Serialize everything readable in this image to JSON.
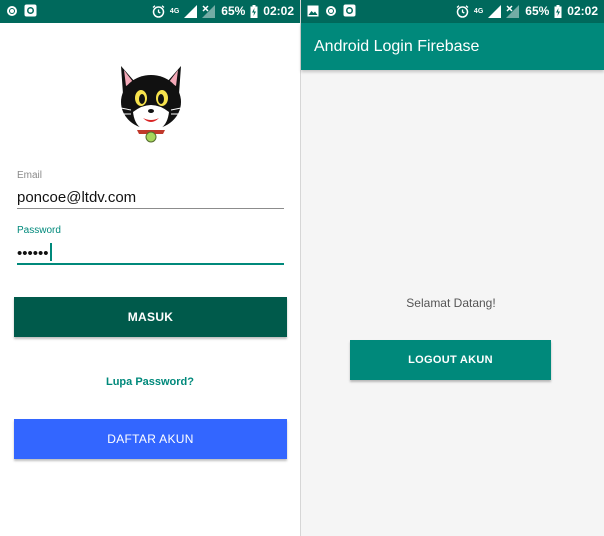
{
  "status_bar_left": {
    "battery_text": "65%",
    "network": "4G",
    "time": "02:02",
    "notification_icons": [
      "circle-icon",
      "camera-record-icon"
    ]
  },
  "status_bar_right": {
    "battery_text": "65%",
    "network": "4G",
    "time": "02:02",
    "notification_icons": [
      "image-icon",
      "circle-icon",
      "camera-record-icon"
    ]
  },
  "login": {
    "email_label": "Email",
    "email_value": "poncoe@ltdv.com",
    "password_label": "Password",
    "password_value": "••••••",
    "login_button": "MASUK",
    "forgot_password": "Lupa Password?",
    "register_button": "DAFTAR AKUN"
  },
  "home": {
    "app_title": "Android Login Firebase",
    "welcome_text": "Selamat Datang!",
    "logout_button": "LOGOUT AKUN"
  },
  "colors": {
    "status_bar": "#00695c",
    "primary": "#00897b",
    "login_button": "#005a4b",
    "register_button": "#3366ff"
  }
}
